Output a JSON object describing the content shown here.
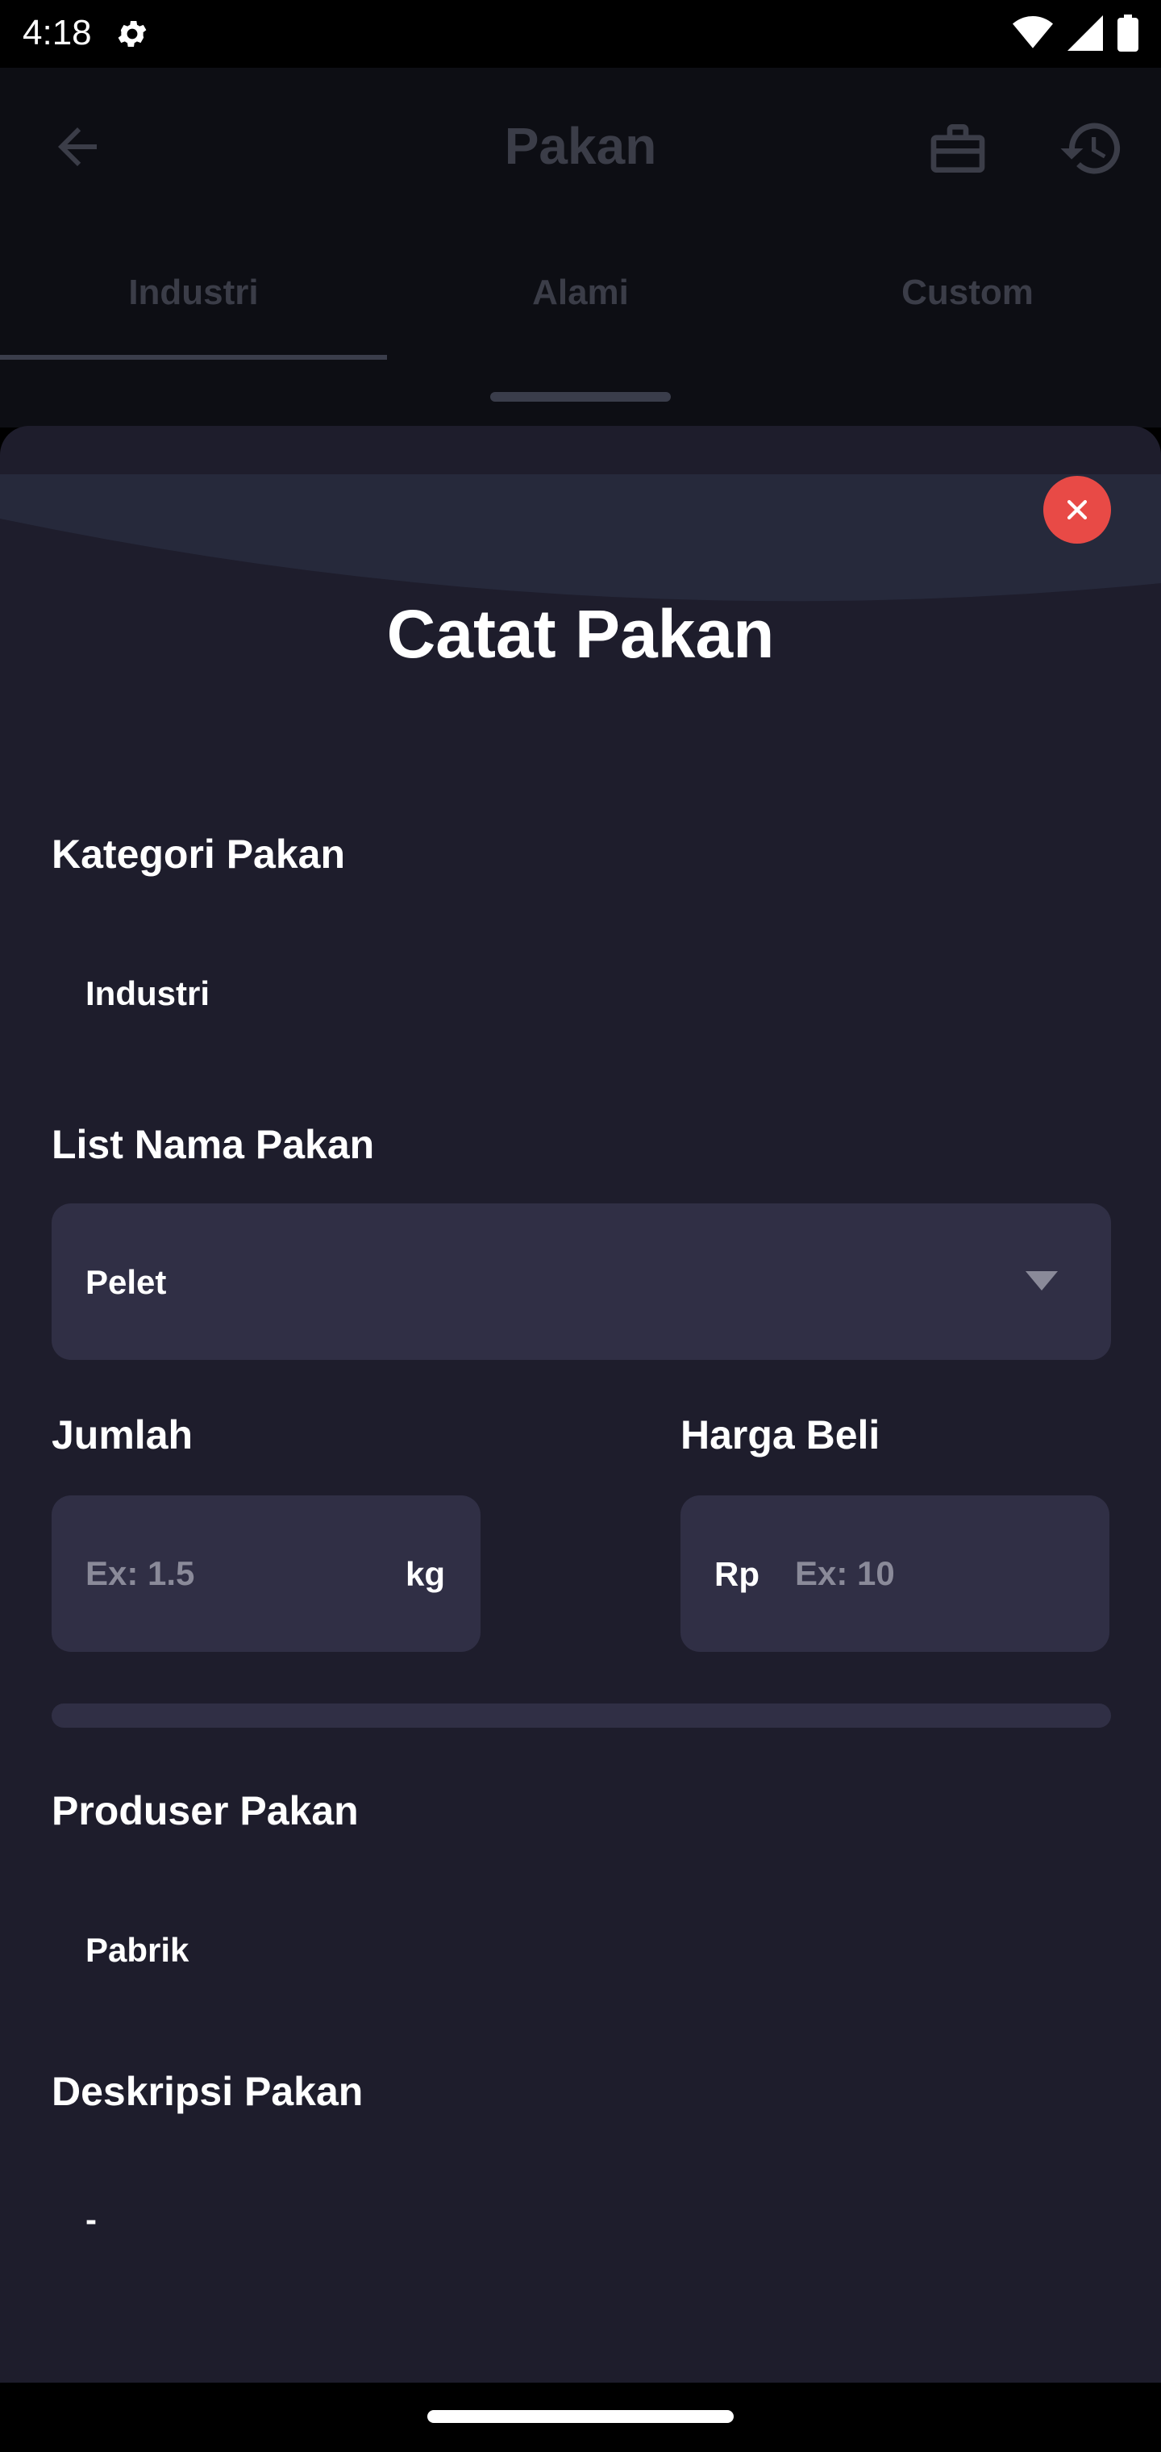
{
  "status_bar": {
    "time": "4:18",
    "icons": [
      "settings-icon",
      "wifi-icon",
      "signal-icon",
      "battery-icon"
    ]
  },
  "app_bar": {
    "title": "Pakan",
    "icons": [
      "back-arrow-icon",
      "briefcase-icon",
      "history-icon"
    ]
  },
  "tabs": [
    {
      "label": "Industri",
      "selected": true
    },
    {
      "label": "Alami",
      "selected": false
    },
    {
      "label": "Custom",
      "selected": false
    }
  ],
  "sheet": {
    "title": "Catat Pakan",
    "close_icon": "close-icon",
    "kategori": {
      "label": "Kategori Pakan",
      "value": "Industri"
    },
    "list_nama": {
      "label": "List Nama Pakan",
      "selected": "Pelet"
    },
    "jumlah": {
      "label": "Jumlah",
      "placeholder": "Ex: 1.5",
      "unit": "kg"
    },
    "harga": {
      "label": "Harga Beli",
      "prefix": "Rp",
      "placeholder": "Ex: 10"
    },
    "produser": {
      "label": "Produser Pakan",
      "value": "Pabrik"
    },
    "deskripsi": {
      "label": "Deskripsi Pakan",
      "value": "-"
    }
  },
  "colors": {
    "sheet_bg": "#1e1d2c",
    "field_bg": "#302f45",
    "close_red": "#e84a46",
    "dim_bg": "#0d0e14"
  }
}
